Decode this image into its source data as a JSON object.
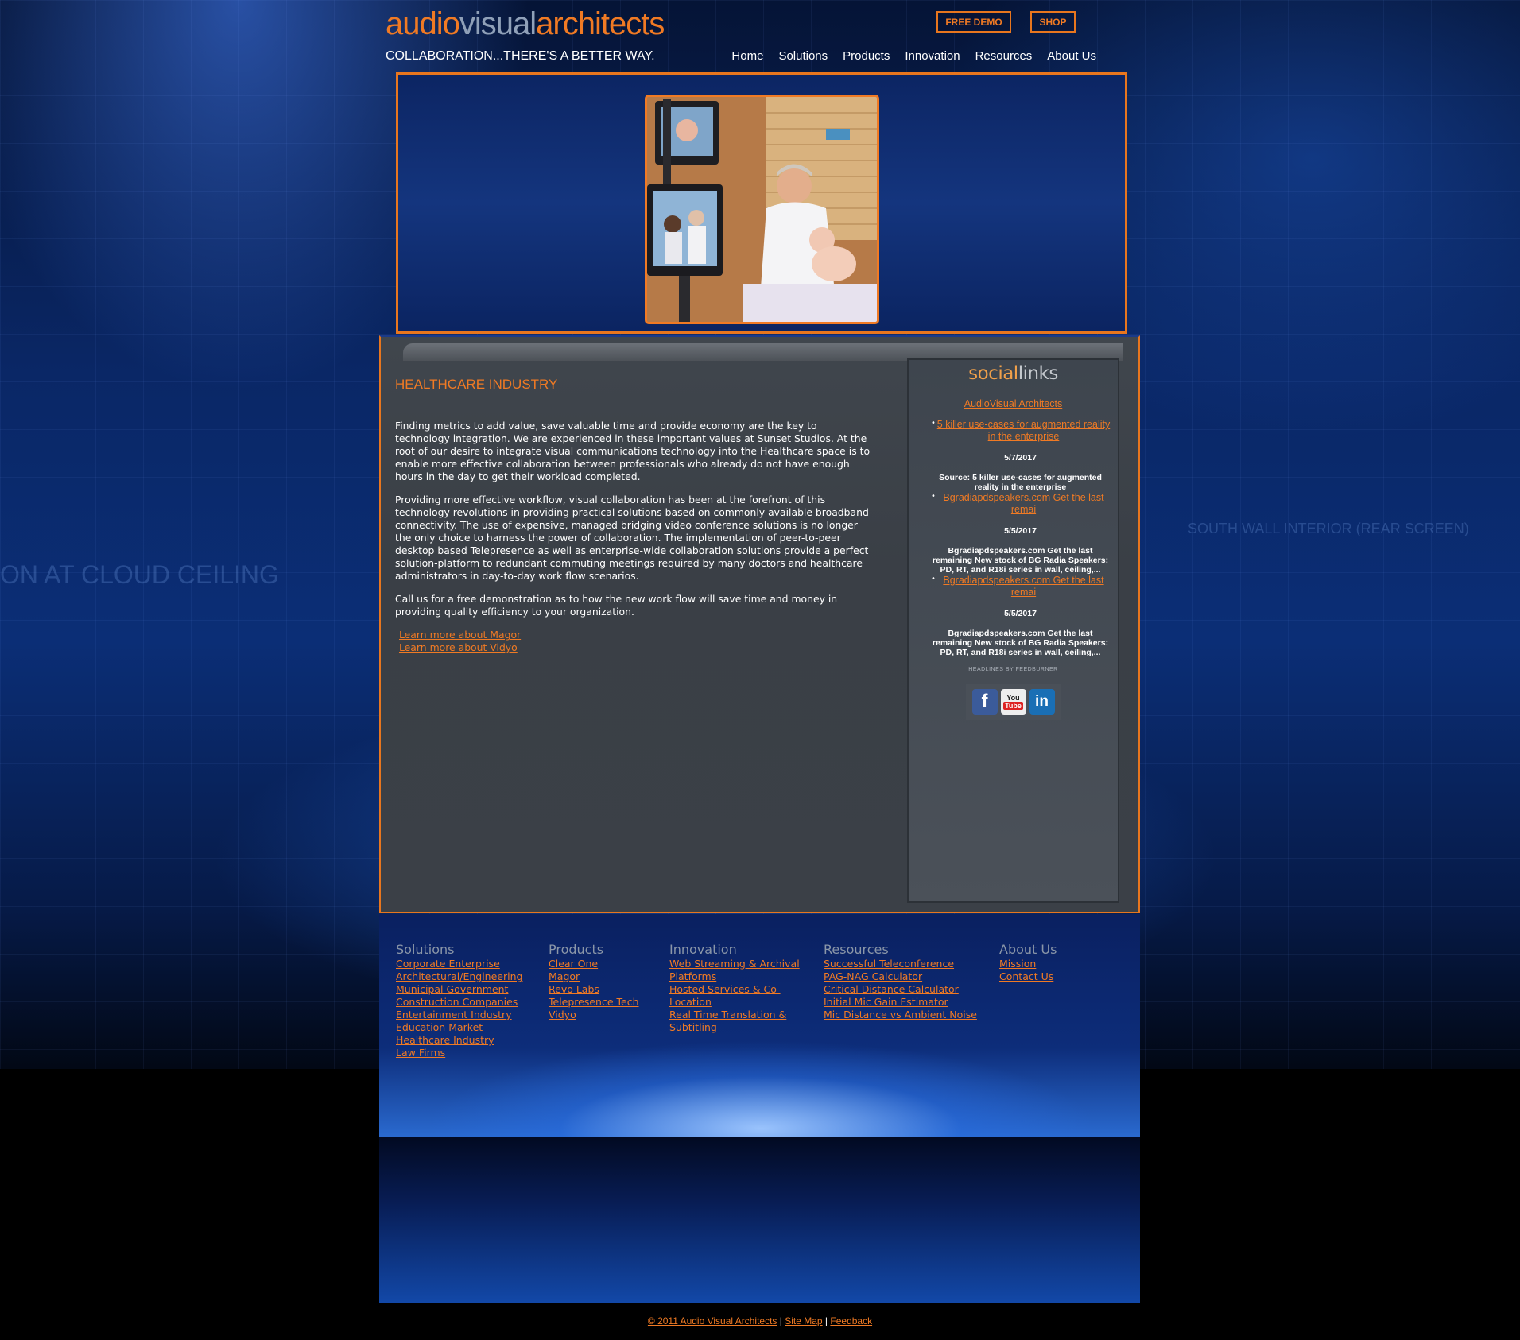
{
  "header": {
    "logo_part1": "audio",
    "logo_part2": "visual",
    "logo_part3": "architects",
    "tagline": "COLLABORATION...THERE'S A BETTER WAY.",
    "free_demo": "FREE DEMO",
    "shop": "SHOP"
  },
  "nav": {
    "items": [
      "Home",
      "Solutions",
      "Products",
      "Innovation",
      "Resources",
      "About Us"
    ]
  },
  "main": {
    "heading": "HEALTHCARE INDUSTRY",
    "paragraphs": [
      "Finding metrics to add value, save valuable time and provide economy are the key to technology integration. We are experienced in these important values at Sunset Studios. At the root of our desire to integrate visual communications technology into the Healthcare space is to enable more effective collaboration between professionals who already do not have enough hours in the day to get their workload completed.",
      "Providing more effective workflow, visual collaboration has been at the forefront of this technology revolutions in providing practical solutions based on commonly available broadband connectivity. The use of expensive, managed bridging video conference solutions is no longer the only choice to harness the power of collaboration. The implementation of peer-to-peer desktop based Telepresence as well as enterprise-wide collaboration solutions provide a perfect solution-platform to redundant commuting meetings required by many doctors and healthcare administrators in day-to-day work flow scenarios.",
      "Call us for a free demonstration as to how the new work flow will save time and money in providing quality efficiency to your organization."
    ],
    "learn_links": [
      "Learn more about Magor",
      "Learn more about Vidyo"
    ]
  },
  "sidebar": {
    "title_part1": "social",
    "title_part2": "links",
    "feed_title": "AudioVisual Architects",
    "feed_items": [
      {
        "link": "5 killer use-cases for augmented reality in the enterprise",
        "date": "5/7/2017",
        "desc": "Source: 5 killer use-cases for augmented reality in the enterprise"
      },
      {
        "link": "Bgradiapdspeakers.com Get the last remai",
        "date": "5/5/2017",
        "desc": "Bgradiapdspeakers.com Get the last remaining New stock of BG Radia Speakers: PD, RT, and R18i series in wall, ceiling,..."
      },
      {
        "link": "Bgradiapdspeakers.com Get the last remai",
        "date": "5/5/2017",
        "desc": "Bgradiapdspeakers.com Get the last remaining New stock of BG Radia Speakers: PD, RT, and R18i series in wall, ceiling,..."
      }
    ],
    "feedburner_text": "HEADLINES BY FEEDBURNER",
    "social_icons": [
      "facebook-icon",
      "youtube-icon",
      "linkedin-icon"
    ],
    "youtube_you": "You",
    "youtube_tube": "Tube",
    "linkedin_text": "in",
    "facebook_text": "f"
  },
  "footer": {
    "columns": [
      {
        "heading": "Solutions",
        "links": [
          "Corporate Enterprise",
          "Architectural/Engineering",
          "Municipal Government",
          "Construction Companies",
          "Entertainment Industry",
          "Education Market",
          "Healthcare Industry",
          "Law Firms"
        ]
      },
      {
        "heading": "Products",
        "links": [
          "Clear One",
          "Magor",
          "Revo Labs",
          "Telepresence Tech",
          "Vidyo"
        ]
      },
      {
        "heading": "Innovation",
        "links": [
          "Web Streaming & Archival Platforms",
          "Hosted Services & Co-Location",
          "Real Time Translation & Subtitling"
        ]
      },
      {
        "heading": "Resources",
        "links": [
          "Successful Teleconference",
          "PAG-NAG Calculator",
          "Critical Distance Calculator",
          "Initial Mic Gain Estimator",
          "Mic Distance vs Ambient Noise"
        ]
      },
      {
        "heading": "About Us",
        "links": [
          "Mission",
          "Contact Us"
        ]
      }
    ]
  },
  "bottom": {
    "copyright": "© 2011 Audio Visual Architects",
    "sep": "|",
    "site_map": "Site Map",
    "feedback": "Feedback"
  },
  "background_text": {
    "left": "ON AT CLOUD CEILING",
    "right": "SOUTH WALL INTERIOR (REAR SCREEN)"
  },
  "colors": {
    "accent": "#f07a24",
    "panel": "#3b4047",
    "background": "#0b2e76"
  }
}
